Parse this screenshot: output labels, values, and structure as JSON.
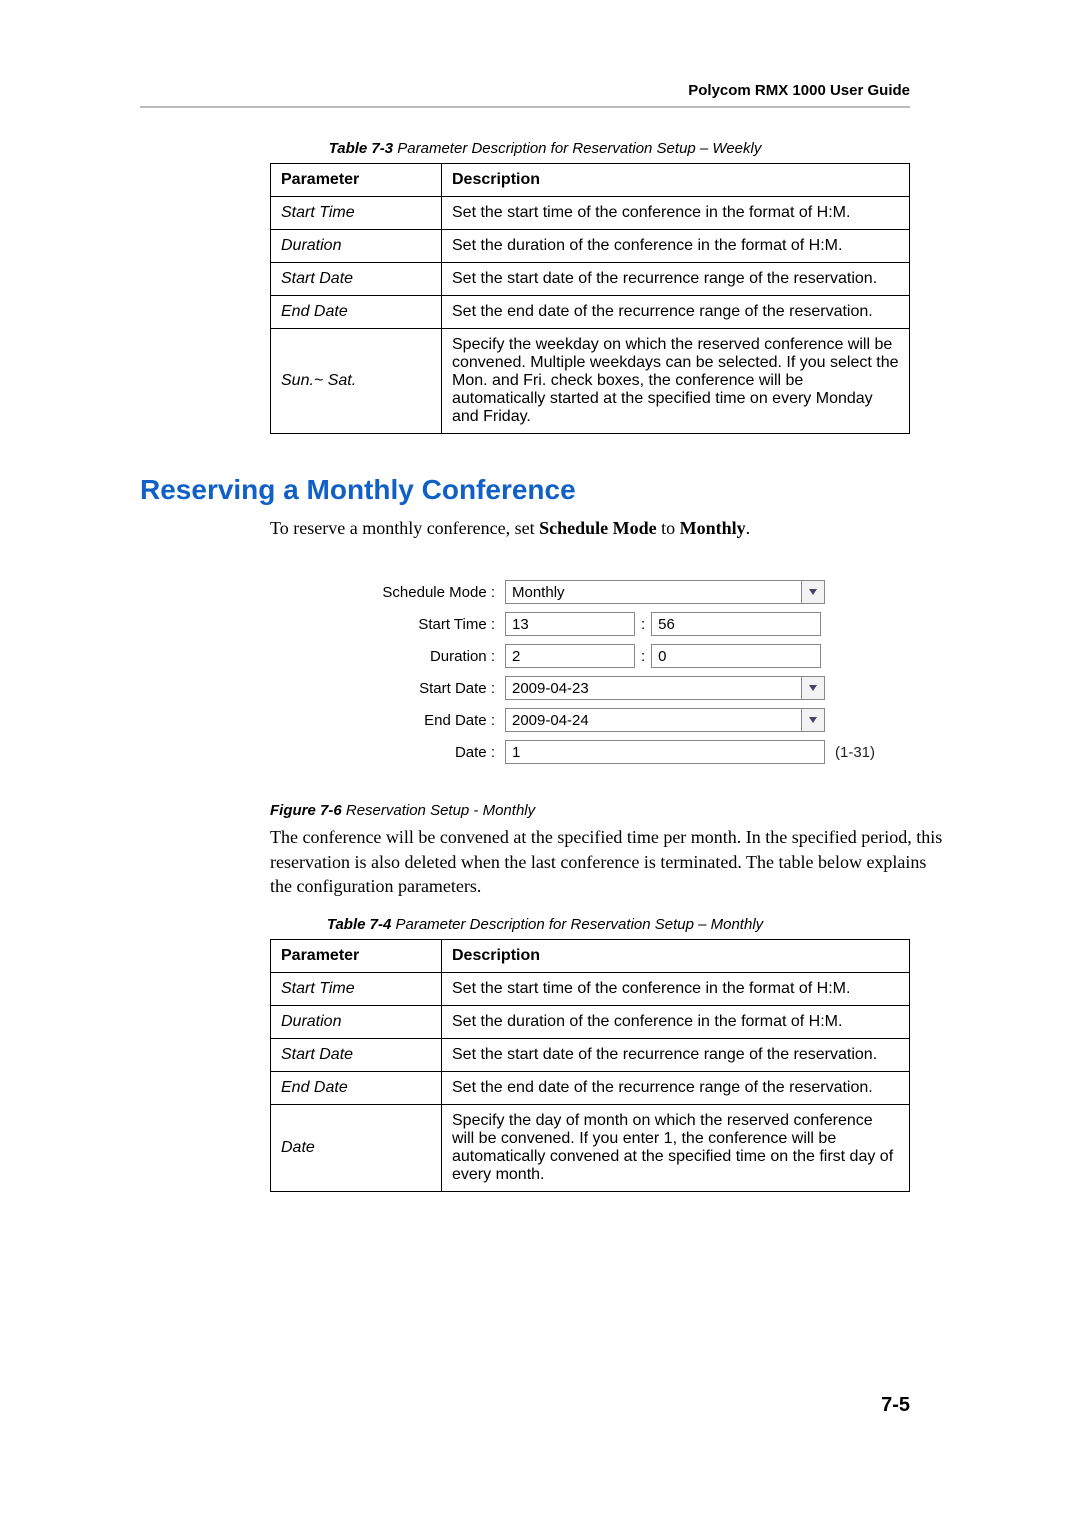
{
  "header": {
    "doc_title": "Polycom RMX 1000 User Guide"
  },
  "table73": {
    "caption_label": "Table 7-3",
    "caption_text": "Parameter Description for Reservation Setup – Weekly",
    "head": {
      "param": "Parameter",
      "desc": "Description"
    },
    "rows": [
      {
        "param": "Start Time",
        "desc": "Set the start time of the conference in the format of H:M."
      },
      {
        "param": "Duration",
        "desc": "Set the duration of the conference in the format of H:M."
      },
      {
        "param": "Start Date",
        "desc": "Set the start date of the recurrence range of the reservation."
      },
      {
        "param": "End Date",
        "desc": "Set the end date of the recurrence range of the reservation."
      },
      {
        "param": "Sun.~ Sat.",
        "desc": "Specify the weekday on which the reserved conference will be convened. Multiple weekdays can be selected. If you select the Mon. and Fri. check boxes, the conference will be automatically started at the specified time on every Monday and Friday."
      }
    ]
  },
  "section": {
    "heading": "Reserving a Monthly Conference",
    "intro_pre": "To reserve a monthly conference, set ",
    "intro_b1": "Schedule Mode",
    "intro_mid": " to ",
    "intro_b2": "Monthly",
    "intro_post": "."
  },
  "form": {
    "labels": {
      "schedule_mode": "Schedule Mode :",
      "start_time": "Start Time :",
      "duration": "Duration :",
      "start_date": "Start Date :",
      "end_date": "End Date :",
      "date": "Date :"
    },
    "values": {
      "schedule_mode": "Monthly",
      "start_h": "13",
      "start_m": "56",
      "dur_h": "2",
      "dur_m": "0",
      "start_date": "2009-04-23",
      "end_date": "2009-04-24",
      "date": "1"
    },
    "range_hint": "(1-31)",
    "colon": ":"
  },
  "figure": {
    "label": "Figure 7-6",
    "text": "Reservation Setup - Monthly"
  },
  "para_after_figure": "The conference will be convened at the specified time per month. In the specified period, this reservation is also deleted when the last conference is terminated. The table below explains the configuration parameters.",
  "table74": {
    "caption_label": "Table 7-4",
    "caption_text": "Parameter Description for Reservation Setup – Monthly",
    "head": {
      "param": "Parameter",
      "desc": "Description"
    },
    "rows": [
      {
        "param": "Start Time",
        "desc": "Set the start time of the conference in the format of H:M."
      },
      {
        "param": "Duration",
        "desc": "Set the duration of the conference in the format of H:M."
      },
      {
        "param": "Start Date",
        "desc": "Set the start date of the recurrence range of the reservation."
      },
      {
        "param": "End Date",
        "desc": "Set the end date of the recurrence range of the reservation."
      },
      {
        "param": "Date",
        "desc": "Specify the day of month on which the reserved conference will be convened. If you enter 1, the conference will be automatically convened at the specified time on the first day of every month."
      }
    ]
  },
  "page_number": "7-5"
}
